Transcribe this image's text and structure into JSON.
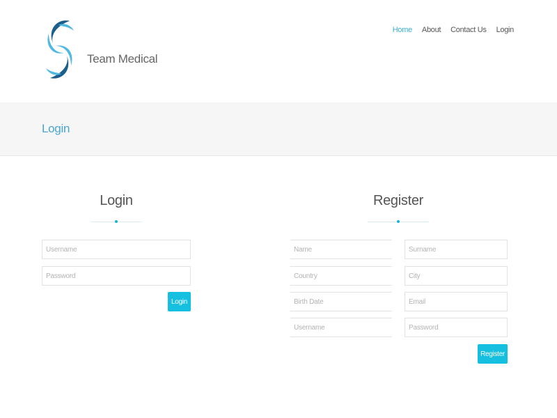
{
  "header": {
    "brand": "Team Medical",
    "nav": [
      {
        "label": "Home",
        "active": true
      },
      {
        "label": "About",
        "active": false
      },
      {
        "label": "Contact Us",
        "active": false
      },
      {
        "label": "Login",
        "active": false
      }
    ]
  },
  "page_title": "Login",
  "login": {
    "heading": "Login",
    "username_placeholder": "Username",
    "password_placeholder": "Password",
    "submit_label": "Login"
  },
  "register": {
    "heading": "Register",
    "name_placeholder": "Name",
    "surname_placeholder": "Surname",
    "country_placeholder": "Country",
    "city_placeholder": "City",
    "birthdate_placeholder": "Birth Date",
    "email_placeholder": "Email",
    "username_placeholder": "Username",
    "password_placeholder": "Password",
    "submit_label": "Register"
  },
  "colors": {
    "accent": "#14bfe0",
    "link_active": "#3aaed8",
    "logo_dark": "#1b5f8c",
    "logo_light": "#4fb8e3"
  }
}
